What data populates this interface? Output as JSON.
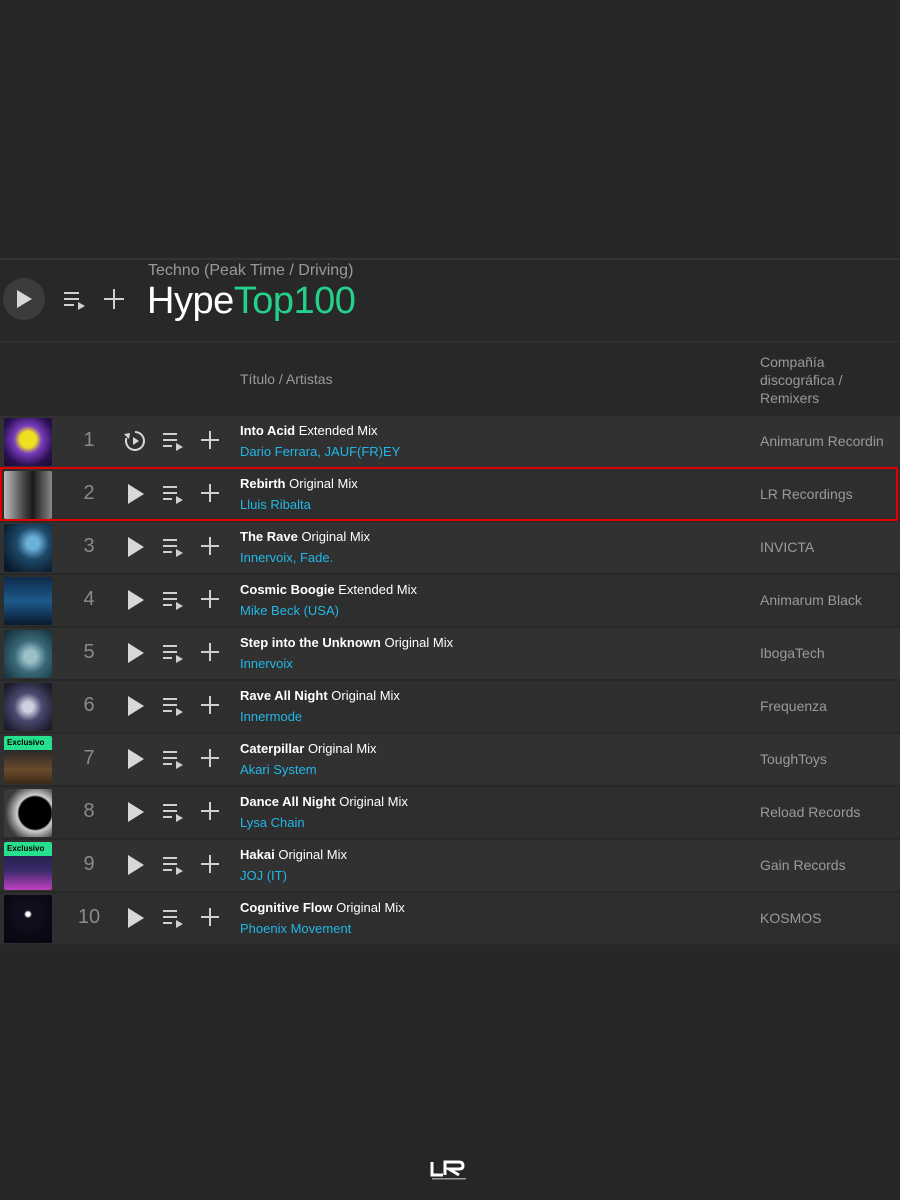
{
  "header": {
    "genre": "Techno (Peak Time / Driving)",
    "title_part1": "Hype",
    "title_part2": "Top100",
    "title_color_accent": "#23d18b"
  },
  "columns": {
    "title_artists": "Título / Artistas",
    "label_remixers": "Compañía discográfica / Remixers"
  },
  "badge_exclusive": "Exclusivo",
  "colors": {
    "artist": "#21b8e8",
    "highlight": "#e00000",
    "exclusive_badge": "#27e08e"
  },
  "tracks": [
    {
      "num": "1",
      "title": "Into Acid",
      "mix": "Extended Mix",
      "artists": "Dario Ferrara, JAUF(FR)EY",
      "label": "Animarum Recordin",
      "icon": "replay-icon",
      "exclusive": false
    },
    {
      "num": "2",
      "title": "Rebirth",
      "mix": "Original Mix",
      "artists": "Lluis Ribalta",
      "label": "LR Recordings",
      "icon": "play-icon",
      "exclusive": false,
      "highlighted": true
    },
    {
      "num": "3",
      "title": "The Rave",
      "mix": "Original Mix",
      "artists": "Innervoix, Fade.",
      "label": "INVICTA",
      "icon": "play-icon",
      "exclusive": false
    },
    {
      "num": "4",
      "title": "Cosmic Boogie",
      "mix": "Extended Mix",
      "artists": "Mike Beck (USA)",
      "label": "Animarum Black",
      "icon": "play-icon",
      "exclusive": false
    },
    {
      "num": "5",
      "title": "Step into the Unknown",
      "mix": "Original Mix",
      "artists": "Innervoix",
      "label": "IbogaTech",
      "icon": "play-icon",
      "exclusive": false
    },
    {
      "num": "6",
      "title": "Rave All Night",
      "mix": "Original Mix",
      "artists": "Innermode",
      "label": "Frequenza",
      "icon": "play-icon",
      "exclusive": false
    },
    {
      "num": "7",
      "title": "Caterpillar",
      "mix": "Original Mix",
      "artists": "Akari System",
      "label": "ToughToys",
      "icon": "play-icon",
      "exclusive": true
    },
    {
      "num": "8",
      "title": "Dance All Night",
      "mix": "Original Mix",
      "artists": "Lysa Chain",
      "label": "Reload Records",
      "icon": "play-icon",
      "exclusive": false
    },
    {
      "num": "9",
      "title": "Hakai",
      "mix": "Original Mix",
      "artists": "JOJ (IT)",
      "label": "Gain Records",
      "icon": "play-icon",
      "exclusive": true
    },
    {
      "num": "10",
      "title": "Cognitive Flow",
      "mix": "Original Mix",
      "artists": "Phoenix Movement",
      "label": "KOSMOS",
      "icon": "play-icon",
      "exclusive": false
    }
  ]
}
